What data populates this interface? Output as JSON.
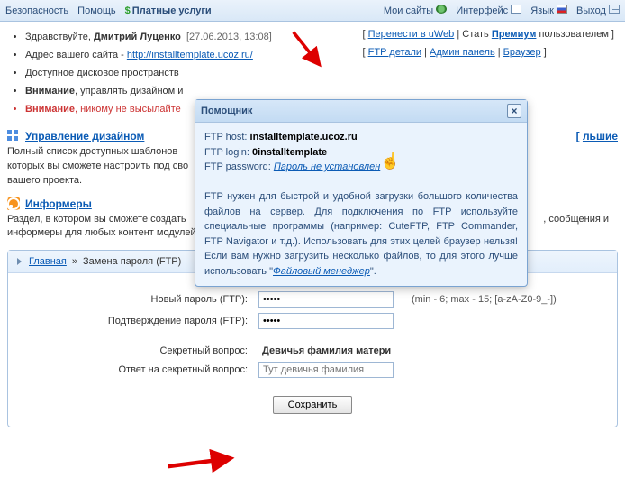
{
  "topmenu": {
    "security": "Безопасность",
    "help": "Помощь",
    "paid": "Платные услуги",
    "mysites": "Мои сайты",
    "interface": "Интерфейс",
    "language": "Язык",
    "logout": "Выход"
  },
  "greeting": {
    "hello": "Здравствуйте, ",
    "name": "Дмитрий Луценко",
    "datetime": "[27.06.2013, 13:08]"
  },
  "toplinks": {
    "transfer": "Перенести в uWeb",
    "premium_pre": "Стать ",
    "premium_bold": "Премиум",
    "premium_post": " пользователем",
    "ftp": "FTP детали",
    "admin": "Админ панель",
    "browser": "Браузер"
  },
  "bullets": {
    "addr_label": "Адрес вашего сайта - ",
    "addr_url": "http://installtemplate.ucoz.ru/",
    "disk": "Доступное дисковое пространств",
    "warn_bold": "Внимание",
    "warn_text": ", управлять дизайном и",
    "danger_bold": "Внимание",
    "danger_text": ", никому не высылайте"
  },
  "sections": {
    "design_title": "Управление дизайном",
    "design_more": "льшие",
    "design_text": "Полный список доступных шаблонов которых вы сможете настроить под сво вашего проекта.",
    "informers_title": "Информеры",
    "informers_text_start": "Раздел, в котором вы сможете создать информеры для любых контент модулей",
    "informers_text_end": ", сообщения и"
  },
  "popup": {
    "title": "Помощник",
    "host_label": "FTP host: ",
    "host": "installtemplate.ucoz.ru",
    "login_label": "FTP login: ",
    "login": "0installtemplate",
    "pass_label": "FTP password: ",
    "pass_link": "Пароль не установлен",
    "body1": "FTP нужен для быстрой и удобной загрузки большого количества файлов на сервер. Для подключения по FTP используйте специальные программы (например: CuteFTP, FTP Commander, FTP Navigator и т.д.). Использовать для этих целей браузер нельзя! Если вам нужно загрузить несколько файлов, то для этого лучше использовать \"",
    "filemgr": "Файловый менеджер",
    "body2": "\"."
  },
  "breadcrumb": {
    "home": "Главная",
    "current": "Замена пароля (FTP)"
  },
  "form": {
    "newpass_label": "Новый пароль (FTP):",
    "confirm_label": "Подтверждение пароля (FTP):",
    "newpass_value": "•••••",
    "confirm_value": "•••••",
    "hint": "(min - 6; max - 15; [a-zA-Z0-9_-])",
    "secq_label": "Секретный вопрос:",
    "secq_value": "Девичья фамилия матери",
    "seca_label": "Ответ на секретный вопрос:",
    "seca_placeholder": "Тут девичья фамилия",
    "save": "Сохранить"
  }
}
